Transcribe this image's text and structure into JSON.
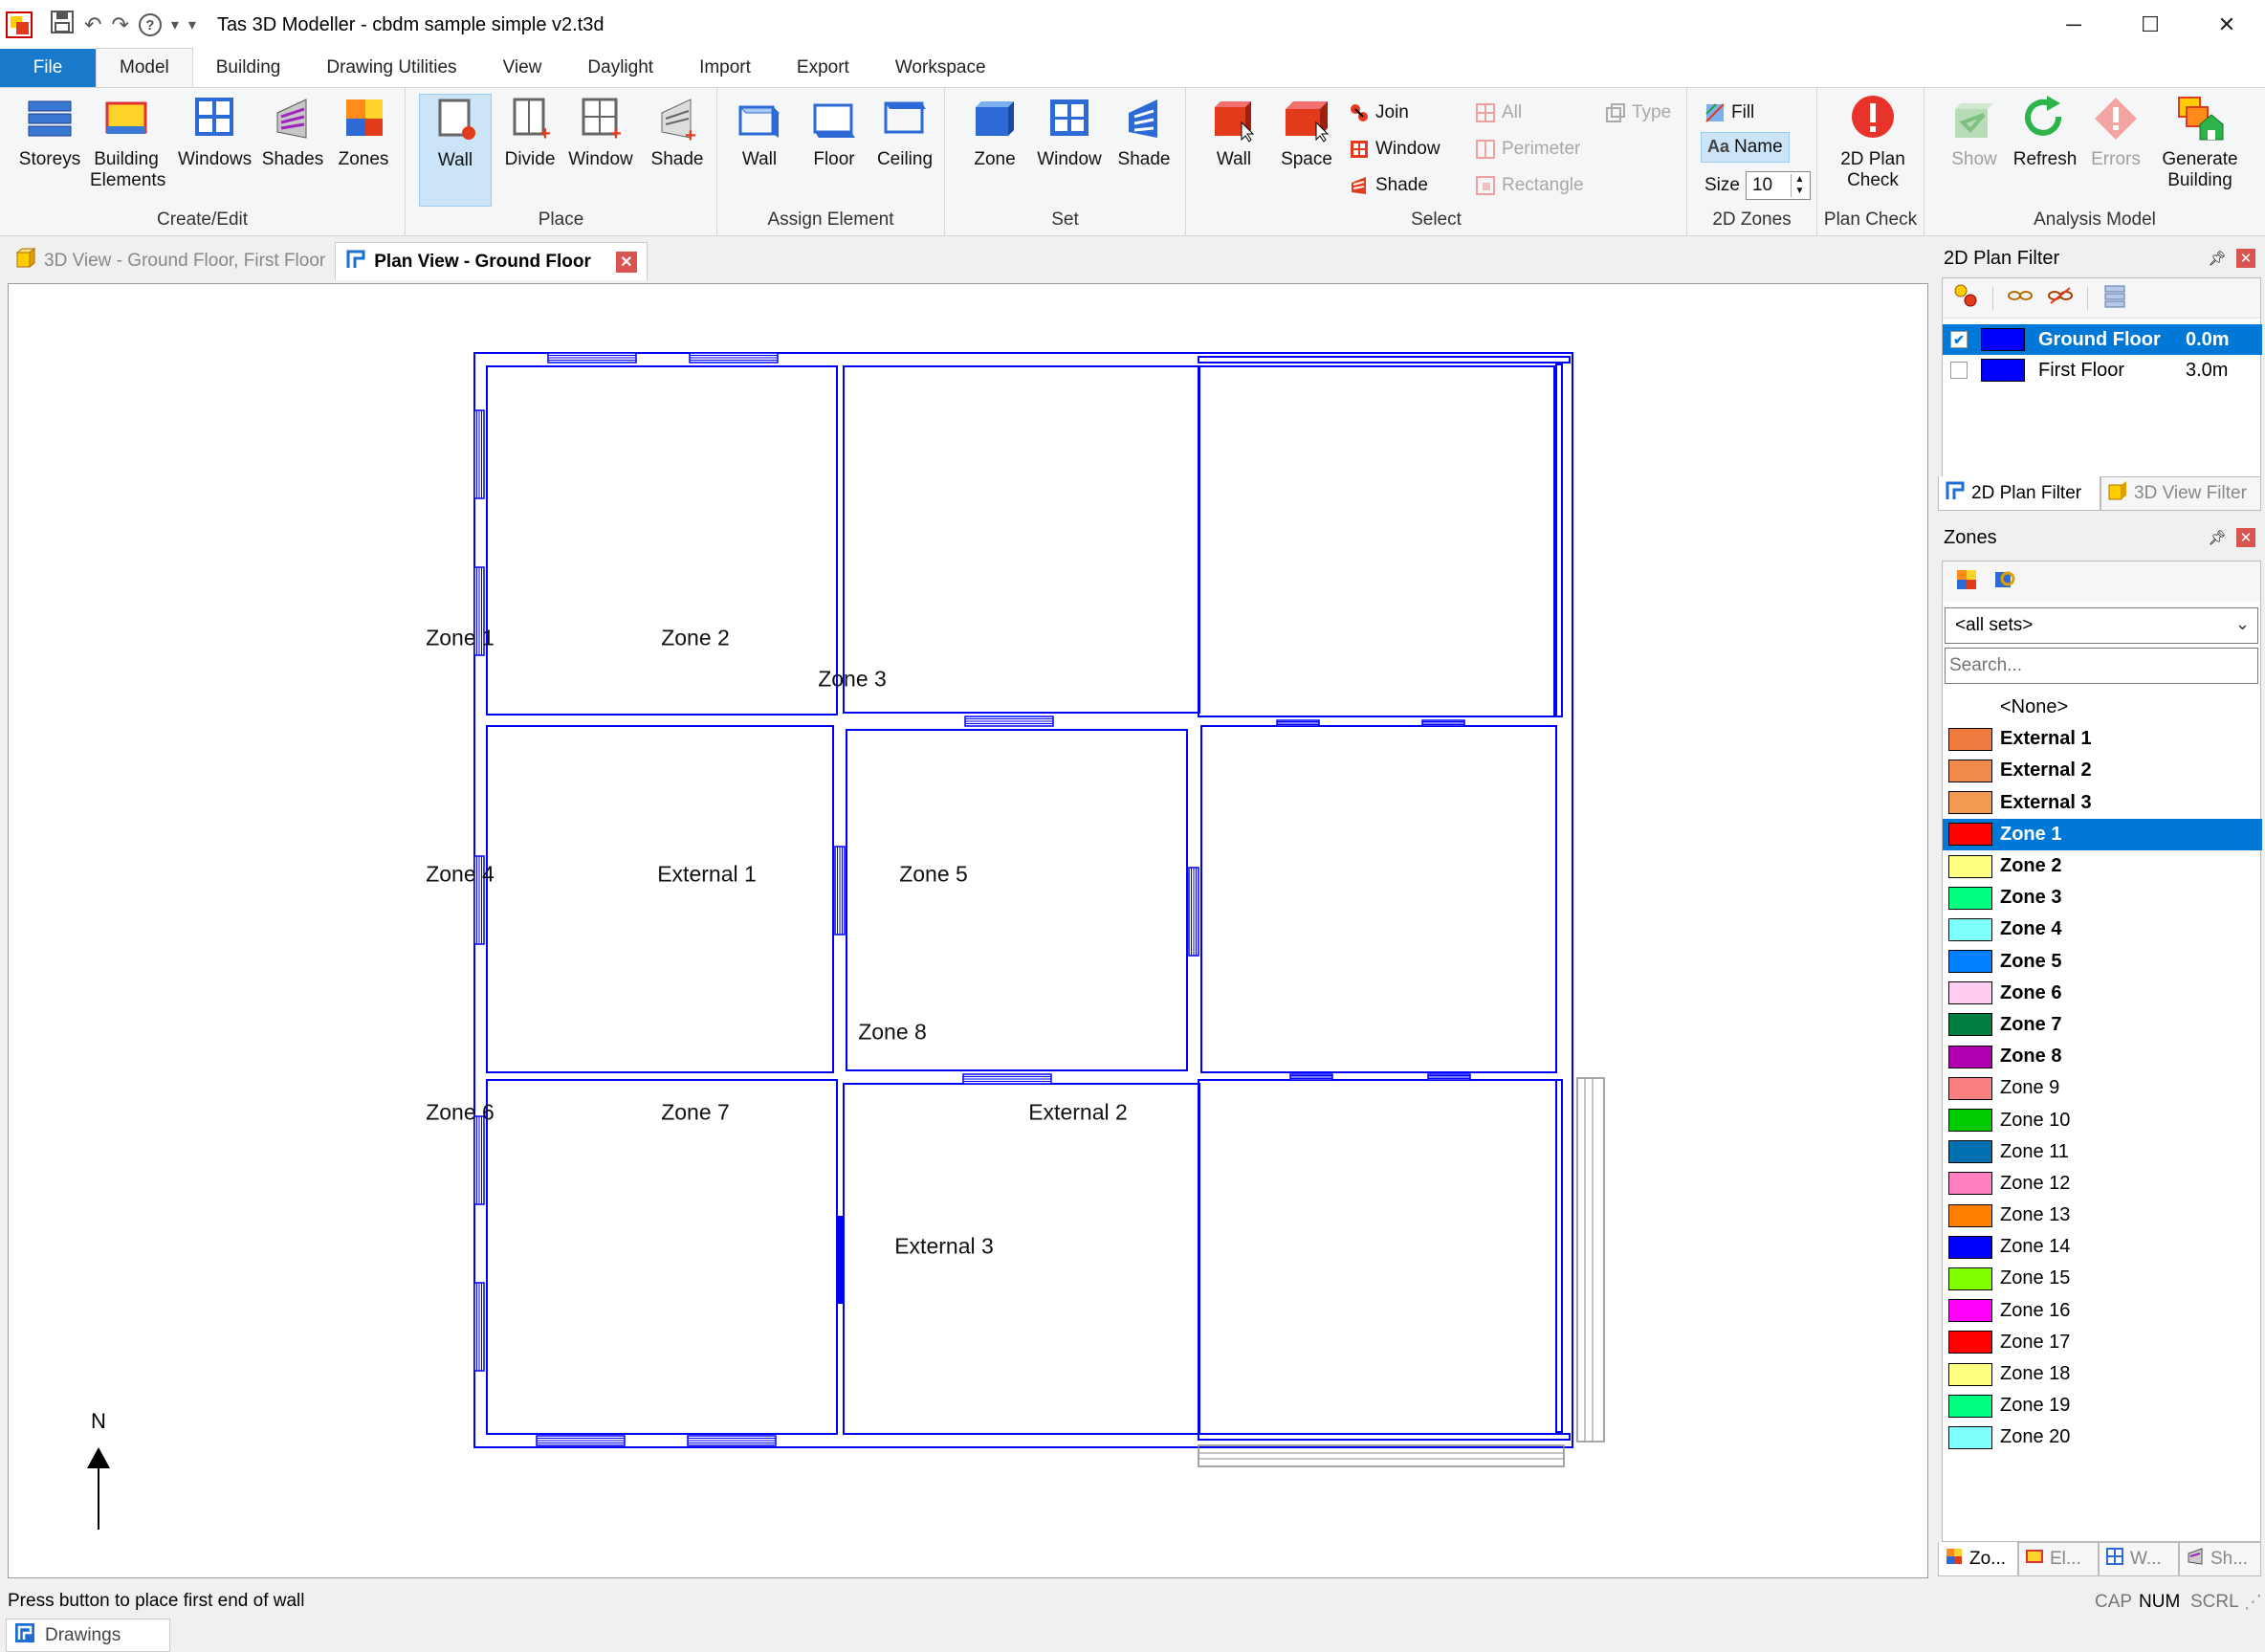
{
  "window": {
    "title": "Tas 3D Modeller - cbdm sample simple v2.t3d",
    "minimize": "─",
    "maximize": "☐",
    "close": "✕"
  },
  "quick_access": {
    "help": "?",
    "dropdown": "▾",
    "customize": "▾"
  },
  "ribbon_tabs": [
    "File",
    "Model",
    "Building",
    "Drawing Utilities",
    "View",
    "Daylight",
    "Import",
    "Export",
    "Workspace"
  ],
  "ribbon": {
    "create_edit": {
      "label": "Create/Edit",
      "buttons": [
        "Storeys",
        "Building Elements",
        "Windows",
        "Shades",
        "Zones"
      ]
    },
    "place": {
      "label": "Place",
      "buttons": [
        "Wall",
        "Divide",
        "Window",
        "Shade"
      ]
    },
    "assign_element": {
      "label": "Assign Element",
      "buttons": [
        "Wall",
        "Floor",
        "Ceiling"
      ]
    },
    "set": {
      "label": "Set",
      "buttons": [
        "Zone",
        "Window",
        "Shade"
      ]
    },
    "select": {
      "label": "Select",
      "big": [
        "Wall",
        "Space"
      ],
      "small1": [
        "Join",
        "Window",
        "Shade"
      ],
      "small2": [
        "All",
        "Perimeter",
        "Rectangle"
      ],
      "small3": [
        "Type"
      ]
    },
    "zones2d": {
      "label": "2D Zones",
      "fill": "Fill",
      "name": "Name",
      "size_label": "Size",
      "size_value": "10"
    },
    "plan_check": {
      "label": "Plan Check",
      "button": "2D Plan Check"
    },
    "analysis_model": {
      "label": "Analysis Model",
      "buttons": [
        "Show",
        "Refresh",
        "Errors",
        "Generate Building"
      ]
    }
  },
  "doc_tabs": [
    {
      "label": "3D View - Ground Floor, First Floor",
      "active": false
    },
    {
      "label": "Plan View - Ground Floor",
      "active": true
    }
  ],
  "plan": {
    "zone_labels": [
      "Zone 1",
      "Zone 2",
      "Zone 3",
      "Zone 4",
      "External 1",
      "Zone 5",
      "Zone 6",
      "Zone 7",
      "Zone 8",
      "External 2",
      "External 3"
    ],
    "north_label": "N",
    "line_color": "#0000ff"
  },
  "filter_panel": {
    "title": "2D Plan Filter",
    "floors": [
      {
        "name": "Ground Floor",
        "height": "0.0m",
        "checked": true,
        "color": "#0000ff"
      },
      {
        "name": "First Floor",
        "height": "3.0m",
        "checked": false,
        "color": "#0000ff"
      }
    ],
    "tabs": [
      "2D Plan Filter",
      "3D View Filter"
    ]
  },
  "zones_panel": {
    "title": "Zones",
    "set_select": "<all sets>",
    "search_placeholder": "Search...",
    "none_item": "<None>",
    "zones": [
      {
        "name": "External 1",
        "color": "#f07b3f",
        "bold": true
      },
      {
        "name": "External 2",
        "color": "#f08a4b",
        "bold": true
      },
      {
        "name": "External 3",
        "color": "#f39b52",
        "bold": true
      },
      {
        "name": "Zone 1",
        "color": "#ff0000",
        "bold": true,
        "selected": true
      },
      {
        "name": "Zone 2",
        "color": "#ffff80",
        "bold": true
      },
      {
        "name": "Zone 3",
        "color": "#00ff80",
        "bold": true
      },
      {
        "name": "Zone 4",
        "color": "#80ffff",
        "bold": true
      },
      {
        "name": "Zone 5",
        "color": "#0080ff",
        "bold": true
      },
      {
        "name": "Zone 6",
        "color": "#ffccf2",
        "bold": true
      },
      {
        "name": "Zone 7",
        "color": "#008040",
        "bold": true
      },
      {
        "name": "Zone 8",
        "color": "#b000b0",
        "bold": true
      },
      {
        "name": "Zone 9",
        "color": "#f88080",
        "bold": false
      },
      {
        "name": "Zone 10",
        "color": "#00cc00",
        "bold": false
      },
      {
        "name": "Zone 11",
        "color": "#0070b0",
        "bold": false
      },
      {
        "name": "Zone 12",
        "color": "#ff80c0",
        "bold": false
      },
      {
        "name": "Zone 13",
        "color": "#ff8000",
        "bold": false
      },
      {
        "name": "Zone 14",
        "color": "#0000ff",
        "bold": false
      },
      {
        "name": "Zone 15",
        "color": "#80ff00",
        "bold": false
      },
      {
        "name": "Zone 16",
        "color": "#ff00ff",
        "bold": false
      },
      {
        "name": "Zone 17",
        "color": "#ff0000",
        "bold": false
      },
      {
        "name": "Zone 18",
        "color": "#ffff80",
        "bold": false
      },
      {
        "name": "Zone 19",
        "color": "#00ff80",
        "bold": false
      },
      {
        "name": "Zone 20",
        "color": "#80ffff",
        "bold": false
      }
    ],
    "tabs": [
      "Zo...",
      "El...",
      "W...",
      "Sh..."
    ]
  },
  "status": {
    "message": "Press button to place first end of wall",
    "cap": "CAP",
    "num": "NUM",
    "scrl": "SCRL",
    "drawings_tab": "Drawings"
  }
}
